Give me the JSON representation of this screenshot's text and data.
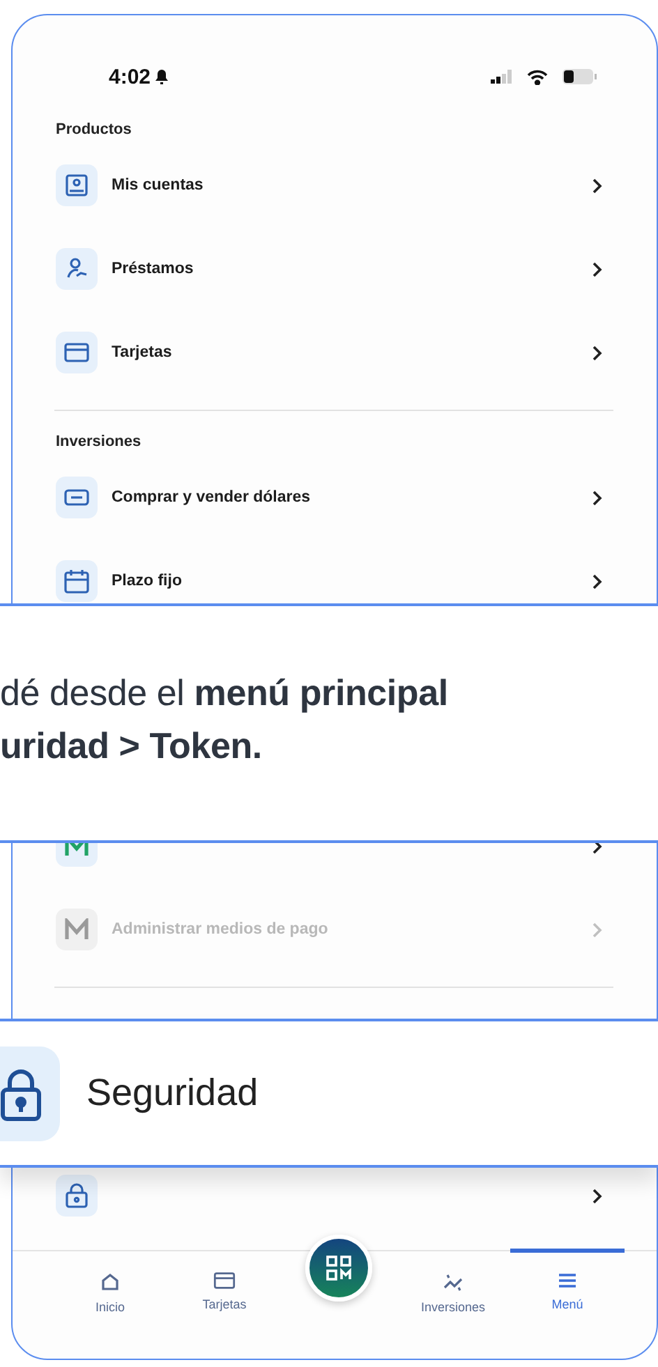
{
  "status_bar": {
    "time": "4:02"
  },
  "sections": [
    {
      "title": "Productos",
      "items": [
        {
          "kind": "account",
          "label": "Mis cuentas",
          "disabled": false
        },
        {
          "kind": "loan",
          "label": "Préstamos",
          "disabled": false
        },
        {
          "kind": "card",
          "label": "Tarjetas",
          "disabled": false
        }
      ]
    },
    {
      "title": "Inversiones",
      "items": [
        {
          "kind": "exchange",
          "label": "Comprar y vender dólares",
          "disabled": false
        },
        {
          "kind": "deposit",
          "label": "Plazo fijo",
          "disabled": false
        }
      ]
    },
    {
      "items": [
        {
          "kind": "modo"
        },
        {
          "kind": "payment",
          "label": "Administrar medios de pago",
          "disabled": true
        }
      ]
    },
    {
      "items": [
        {
          "kind": "security"
        }
      ]
    }
  ],
  "bottom_nav": [
    {
      "kind": "home",
      "label": "Inicio",
      "selected": false
    },
    {
      "kind": "card",
      "label": "Tarjetas",
      "selected": false
    },
    {
      "kind": "qr",
      "selected": false
    },
    {
      "kind": "invest",
      "label": "Inversiones",
      "selected": false
    },
    {
      "kind": "menu",
      "label": "Menú",
      "selected": true
    }
  ],
  "tip_banner": {
    "lines": [
      {
        "text": "dé desde el **menú principal**",
        "bold": false
      },
      {
        "text": "uridad > Token.",
        "bold": true
      }
    ]
  },
  "feature_card": {
    "kind": "security",
    "label": "Seguridad"
  }
}
